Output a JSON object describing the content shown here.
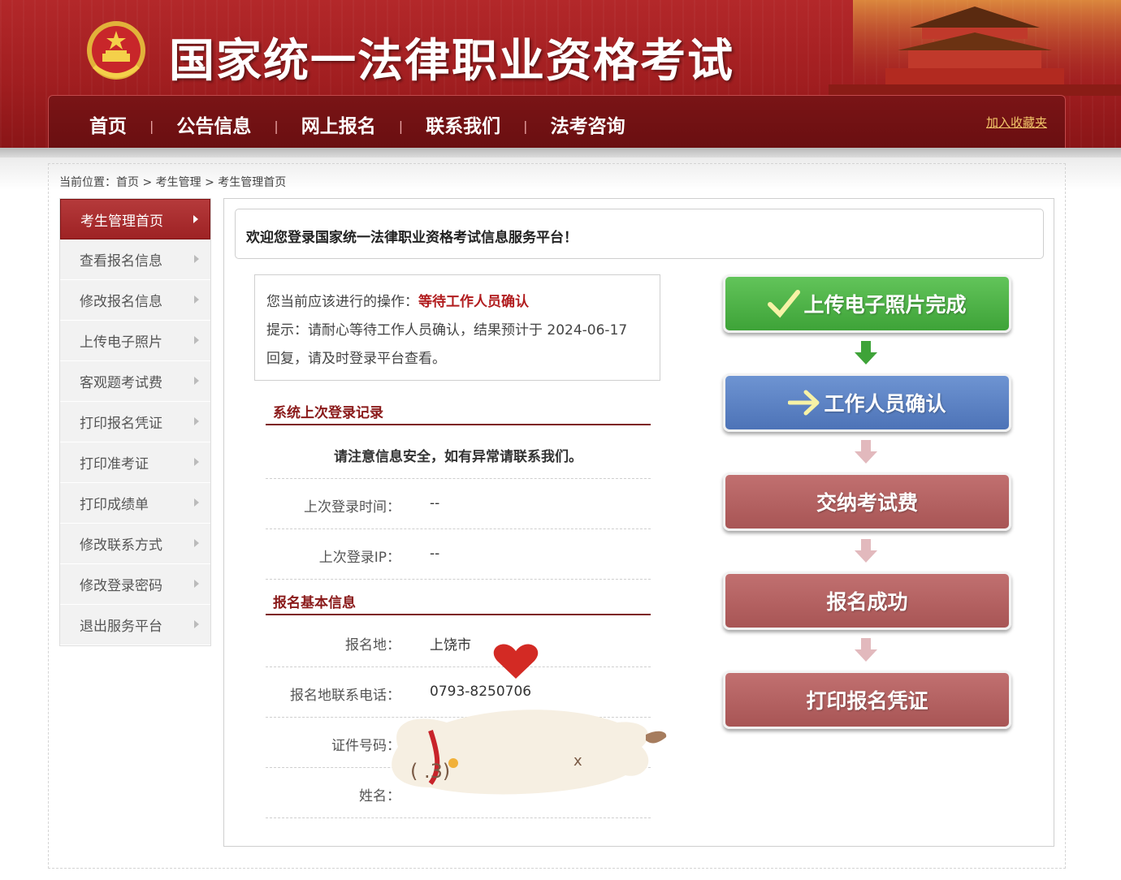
{
  "header": {
    "site_title": "国家统一法律职业资格考试",
    "favorite_link": "加入收藏夹",
    "nav": [
      "首页",
      "公告信息",
      "网上报名",
      "联系我们",
      "法考咨询"
    ]
  },
  "breadcrumb": "当前位置：首页 > 考生管理 > 考生管理首页",
  "sidebar": {
    "items": [
      {
        "label": "考生管理首页",
        "active": true
      },
      {
        "label": "查看报名信息"
      },
      {
        "label": "修改报名信息"
      },
      {
        "label": "上传电子照片"
      },
      {
        "label": "客观题考试费"
      },
      {
        "label": "打印报名凭证"
      },
      {
        "label": "打印准考证"
      },
      {
        "label": "打印成绩单"
      },
      {
        "label": "修改联系方式"
      },
      {
        "label": "修改登录密码"
      },
      {
        "label": "退出服务平台"
      }
    ]
  },
  "welcome": "欢迎您登录国家统一法律职业资格考试信息服务平台！",
  "operation": {
    "prefix": "您当前应该进行的操作：",
    "action": "等待工作人员确认",
    "hint_line1": "提示：请耐心等待工作人员确认，结果预计于 2024-06-17",
    "hint_line2": "回复，请及时登录平台查看。"
  },
  "login_record": {
    "title": "系统上次登录记录",
    "notice": "请注意信息安全，如有异常请联系我们。",
    "last_time_label": "上次登录时间：",
    "last_time_value": "--",
    "last_ip_label": "上次登录IP：",
    "last_ip_value": "--"
  },
  "basic_info": {
    "title": "报名基本信息",
    "place_label": "报名地：",
    "place_value": "上饶市",
    "phone_label": "报名地联系电话：",
    "phone_value": "0793-8250706",
    "id_label": "证件号码：",
    "id_value": "",
    "name_label": "姓名：",
    "name_value": ""
  },
  "steps": [
    {
      "label": "上传电子照片完成",
      "status": "done"
    },
    {
      "label": "工作人员确认",
      "status": "current"
    },
    {
      "label": "交纳考试费",
      "status": "todo"
    },
    {
      "label": "报名成功",
      "status": "todo"
    },
    {
      "label": "打印报名凭证",
      "status": "todo"
    }
  ],
  "colors": {
    "header_red": "#a11e20",
    "step_done": "#4db346",
    "step_current": "#5a82c4",
    "step_todo": "#b56262",
    "accent_text": "#b11c1e"
  }
}
